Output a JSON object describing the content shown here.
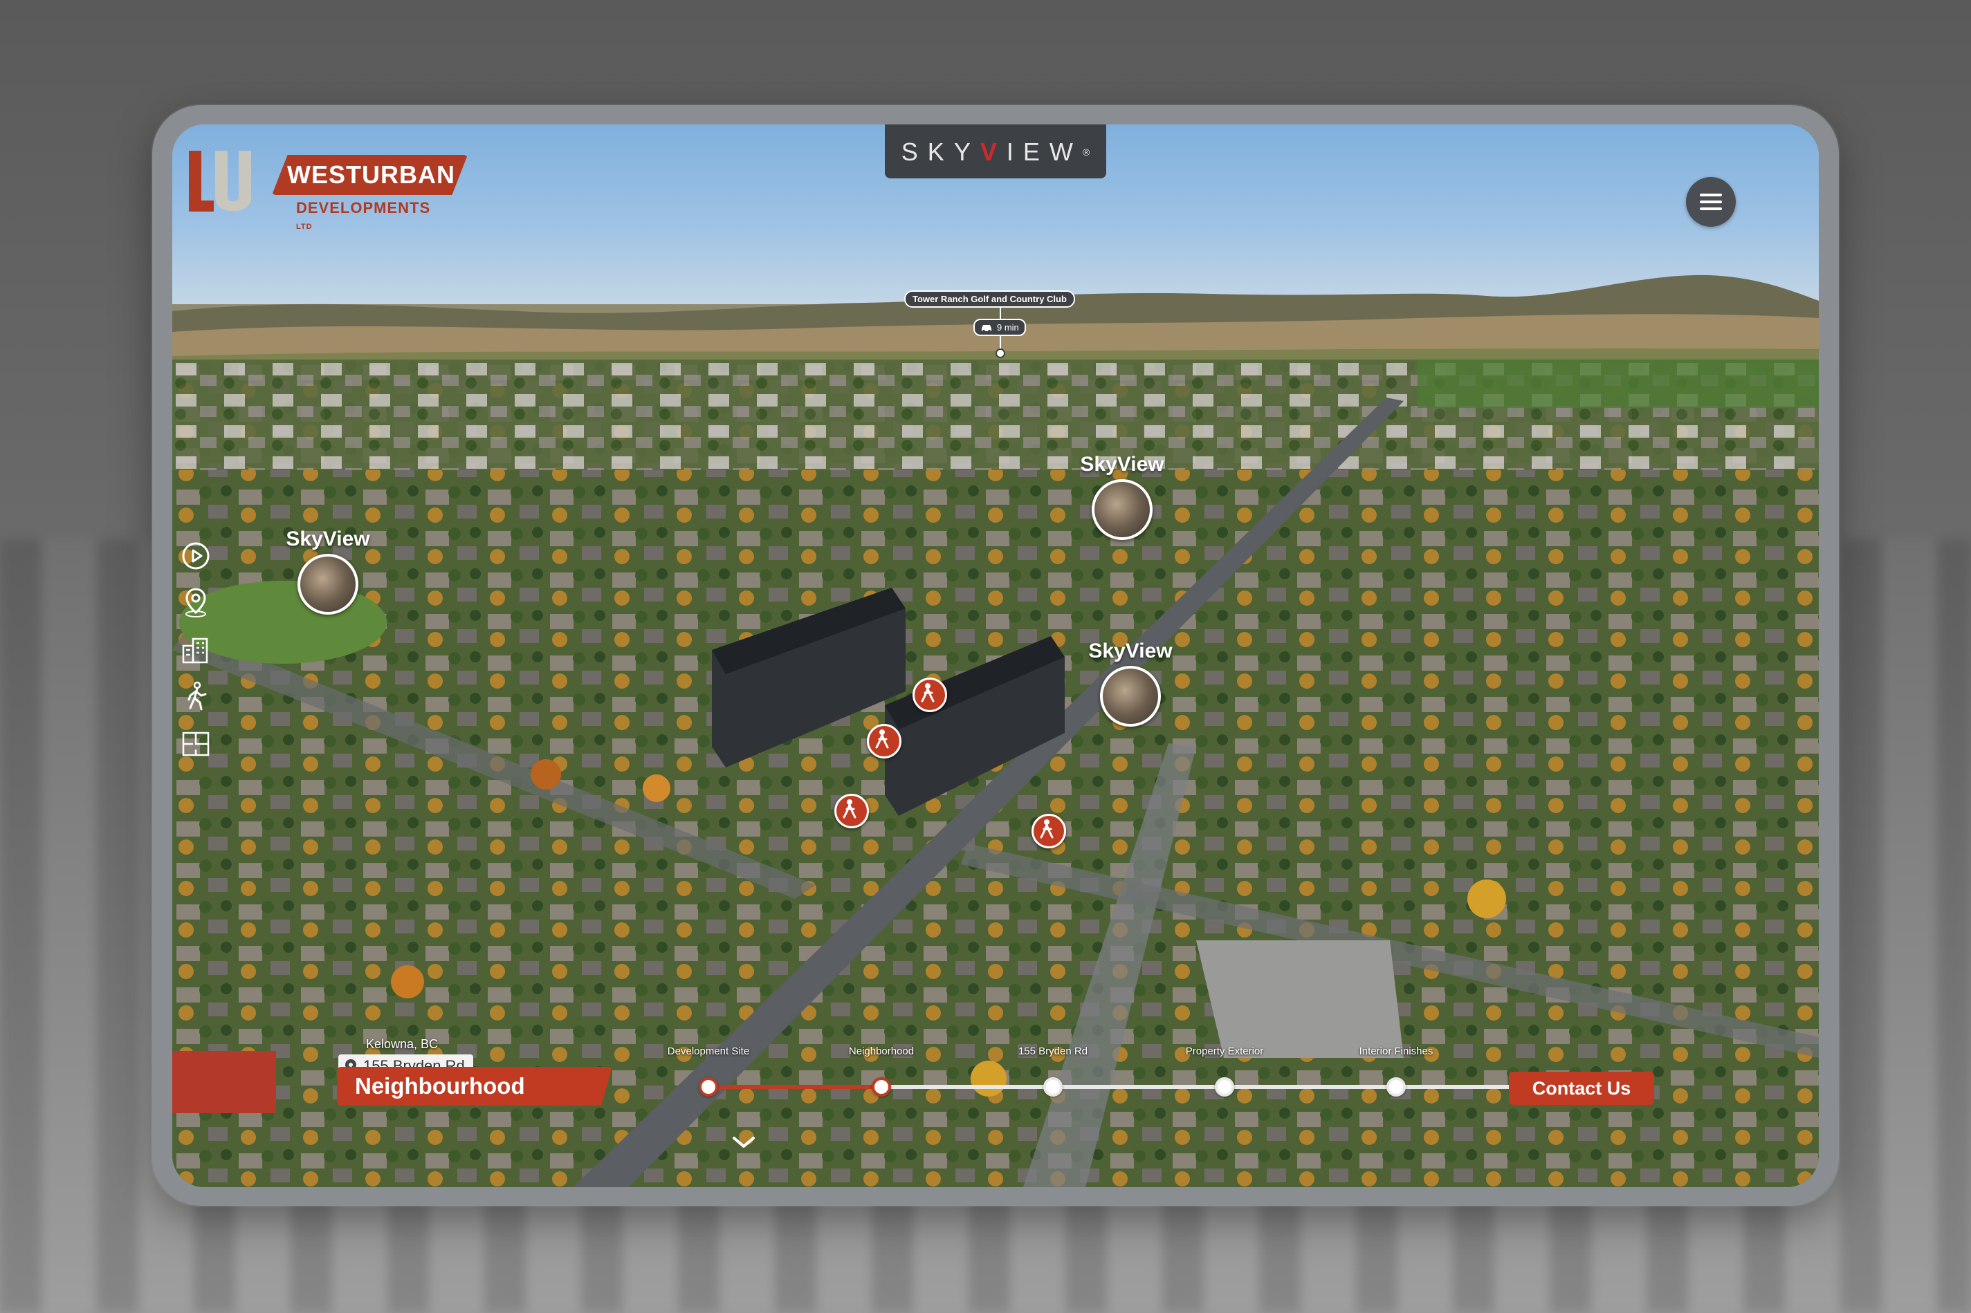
{
  "header": {
    "logo_word": "WESTURBAN",
    "logo_sub": "DEVELOPMENTS",
    "logo_ltd": "LTD",
    "brand_left": "SKY",
    "brand_v": "V",
    "brand_right": "IEW",
    "brand_reg": "®"
  },
  "poi": {
    "label": "Tower Ranch Golf and Country Club",
    "drive_time": "9 min"
  },
  "skyview_pins": [
    {
      "label": "SkyView"
    },
    {
      "label": "SkyView"
    },
    {
      "label": "SkyView"
    }
  ],
  "side_nav": {
    "items": [
      {
        "icon": "play-icon"
      },
      {
        "icon": "location-icon"
      },
      {
        "icon": "building-icon"
      },
      {
        "icon": "walk-icon"
      },
      {
        "icon": "floorplan-icon"
      }
    ]
  },
  "address": {
    "city": "Kelowna, BC",
    "street": "155 Bryden Rd"
  },
  "section": {
    "current": "Neighbourhood"
  },
  "timeline": {
    "steps": [
      {
        "label": "Development Site",
        "done": true
      },
      {
        "label": "Neighborhood",
        "done": true
      },
      {
        "label": "155 Bryden Rd",
        "done": false
      },
      {
        "label": "Property Exterior",
        "done": false
      },
      {
        "label": "Interior Finishes",
        "done": false
      }
    ],
    "progress": 0.2
  },
  "contact": {
    "label": "Contact Us"
  },
  "colors": {
    "accent": "#c13a22",
    "panel": "#3d4145",
    "brand_v": "#d1282e"
  }
}
